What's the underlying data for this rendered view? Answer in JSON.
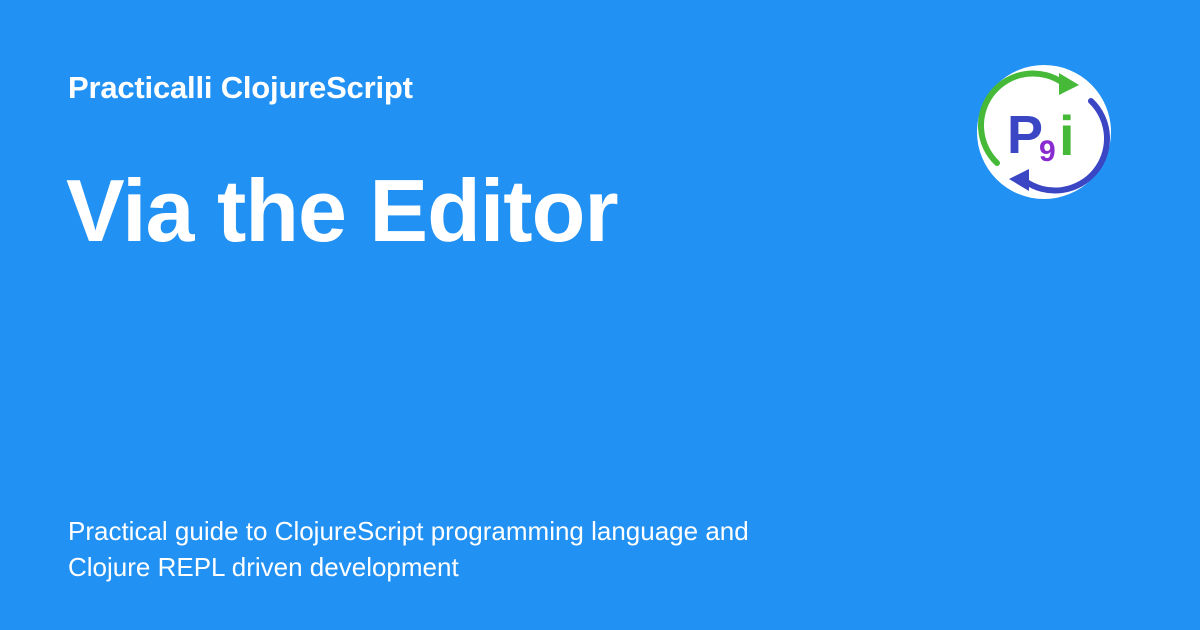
{
  "colors": {
    "background": "#2191f3",
    "text": "#ffffff",
    "logo_green": "#46b938",
    "logo_blue": "#3a46c4",
    "logo_purple": "#8a2bd0"
  },
  "header": {
    "site_name": "Practicalli ClojureScript"
  },
  "main": {
    "title": "Via the Editor"
  },
  "footer": {
    "description_lines": [
      "Practical guide to ClojureScript programming language and",
      "Clojure REPL driven development"
    ]
  },
  "logo": {
    "icon": "practicalli-logo-icon",
    "letters": [
      "P",
      "9",
      "i"
    ]
  }
}
